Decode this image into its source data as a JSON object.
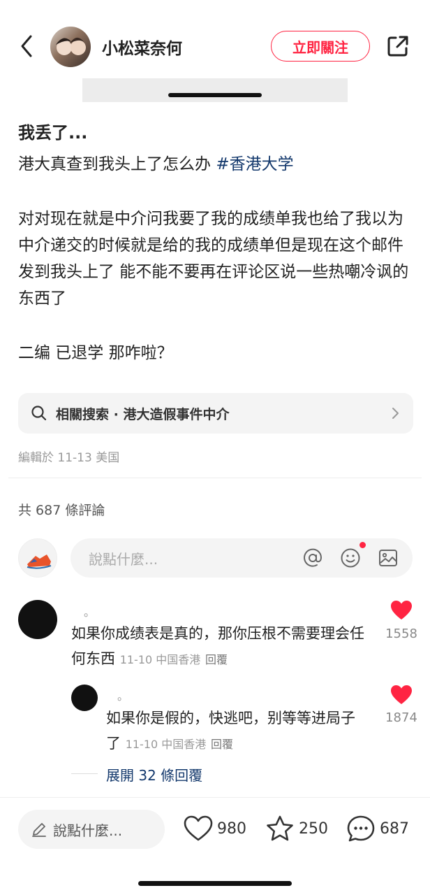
{
  "header": {
    "author_name": "小松菜奈何",
    "follow_label": "立即關注"
  },
  "post": {
    "title": "我丢了...",
    "line1": "港大真查到我头上了怎么办 ",
    "hashtag": "#香港大学",
    "paragraph2": "对对现在就是中介问我要了我的成绩单我也给了我以为中介递交的时候就是给的我的成绩单但是现在这个邮件发到我头上了 能不能不要再在评论区说一些热嘲冷讽的东西了",
    "paragraph3": "二编 已退学 那咋啦？"
  },
  "related_search": {
    "label": "相關搜索 · 港大造假事件中介"
  },
  "edit_meta": "編輯於 11-13 美国",
  "comments_header": "共 687 條評論",
  "comment_input": {
    "placeholder": "說點什麼..."
  },
  "comments": [
    {
      "name": "。",
      "text": "如果你成绩表是真的，那你压根不需要理会任何东西",
      "meta": "11-10 中国香港",
      "reply_label": "回覆",
      "likes": "1558"
    },
    {
      "name": "。",
      "text": "如果你是假的，快逃吧，别等等进局子了",
      "meta": "11-10 中国香港",
      "reply_label": "回覆",
      "likes": "1874"
    }
  ],
  "expand_replies": "展開 32 條回覆",
  "bottom_bar": {
    "input_placeholder": "說點什麼...",
    "likes": "980",
    "favorites": "250",
    "comments": "687"
  },
  "colors": {
    "accent": "#ff2442",
    "link": "#13386c"
  },
  "icons": [
    "back-icon",
    "share-icon",
    "search-icon",
    "chevron-right-icon",
    "at-icon",
    "emoji-icon",
    "image-icon",
    "heart-icon",
    "star-icon",
    "comment-icon",
    "pencil-icon"
  ]
}
